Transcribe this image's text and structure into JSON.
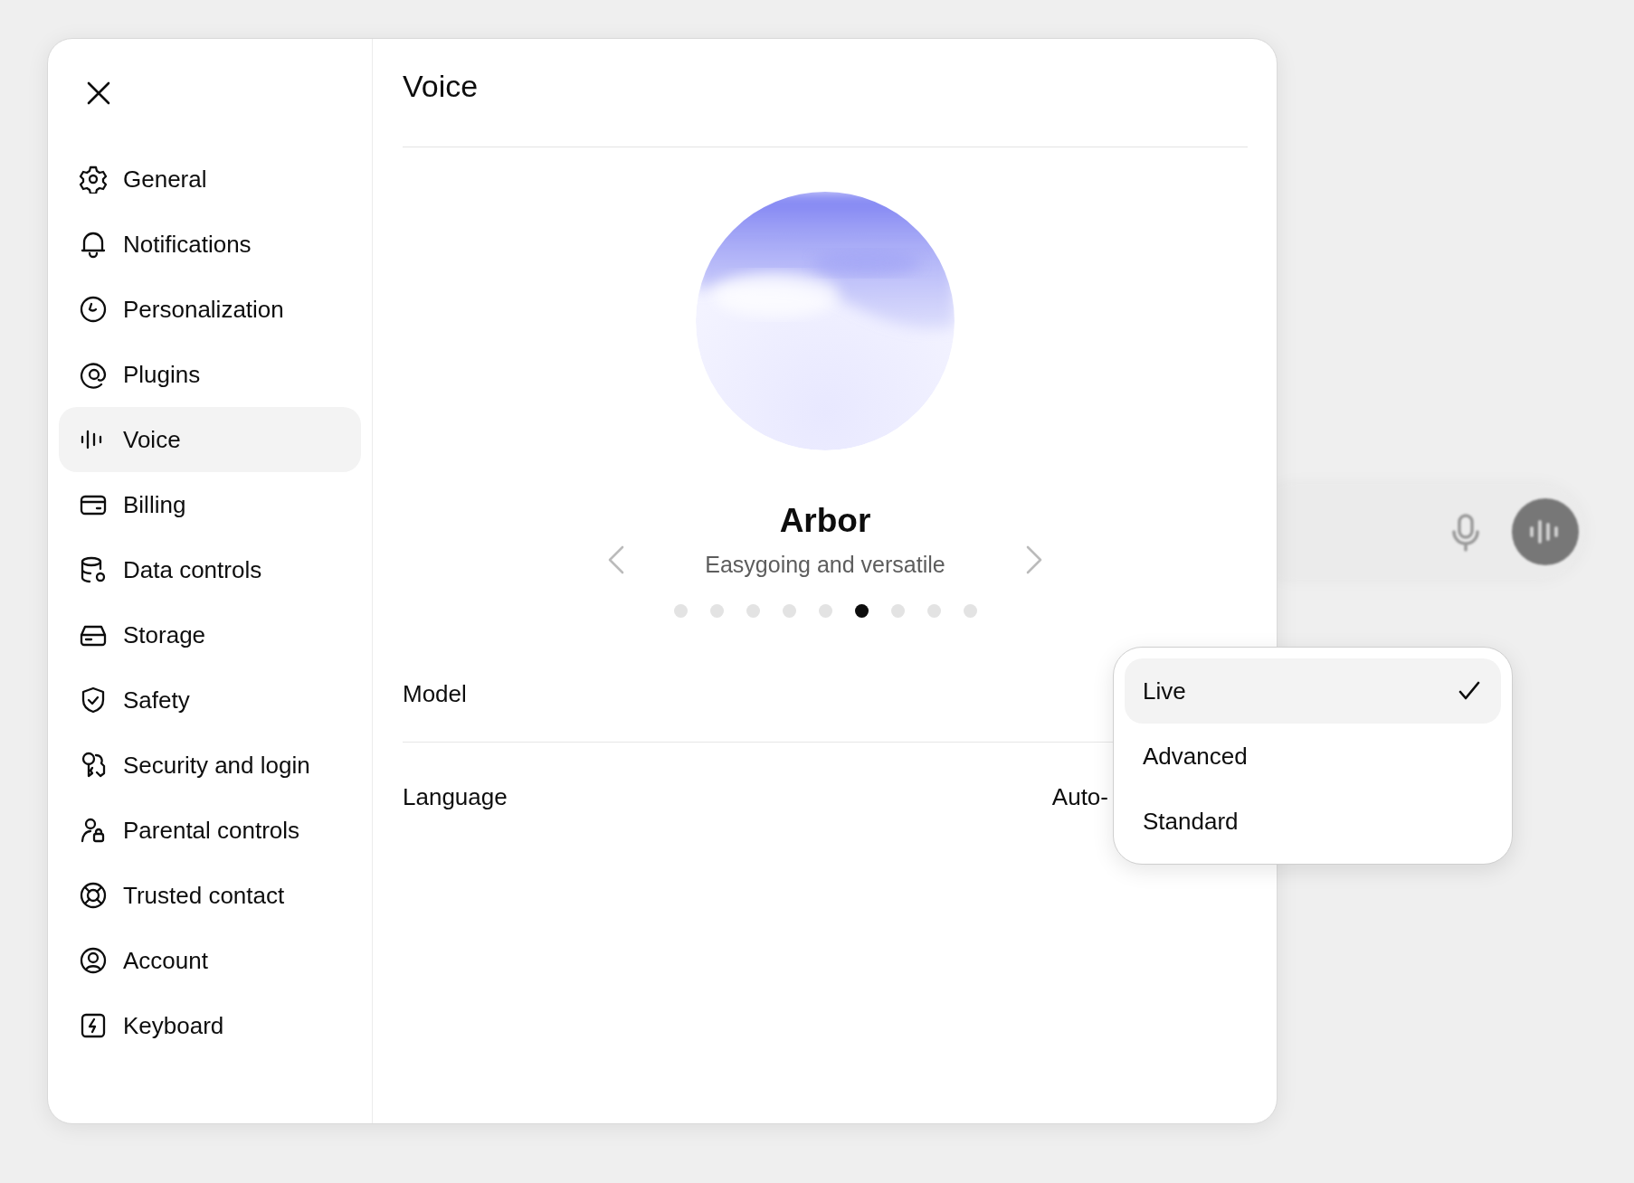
{
  "sidebar": {
    "items": [
      {
        "label": "General",
        "selected": false
      },
      {
        "label": "Notifications",
        "selected": false
      },
      {
        "label": "Personalization",
        "selected": false
      },
      {
        "label": "Plugins",
        "selected": false
      },
      {
        "label": "Voice",
        "selected": true
      },
      {
        "label": "Billing",
        "selected": false
      },
      {
        "label": "Data controls",
        "selected": false
      },
      {
        "label": "Storage",
        "selected": false
      },
      {
        "label": "Safety",
        "selected": false
      },
      {
        "label": "Security and login",
        "selected": false
      },
      {
        "label": "Parental controls",
        "selected": false
      },
      {
        "label": "Trusted contact",
        "selected": false
      },
      {
        "label": "Account",
        "selected": false
      },
      {
        "label": "Keyboard",
        "selected": false
      }
    ]
  },
  "content": {
    "title": "Voice",
    "voice": {
      "name": "Arbor",
      "description": "Easygoing and versatile"
    },
    "dots": [
      {
        "selected": false
      },
      {
        "selected": false
      },
      {
        "selected": false
      },
      {
        "selected": false
      },
      {
        "selected": false
      },
      {
        "selected": true
      },
      {
        "selected": false
      },
      {
        "selected": false
      },
      {
        "selected": false
      }
    ],
    "settings": [
      {
        "label": "Model"
      },
      {
        "label": "Language",
        "value": "Auto-"
      }
    ]
  },
  "model_menu": {
    "options": [
      {
        "label": "Live",
        "selected": true
      },
      {
        "label": "Advanced",
        "selected": false
      },
      {
        "label": "Standard",
        "selected": false
      }
    ]
  }
}
